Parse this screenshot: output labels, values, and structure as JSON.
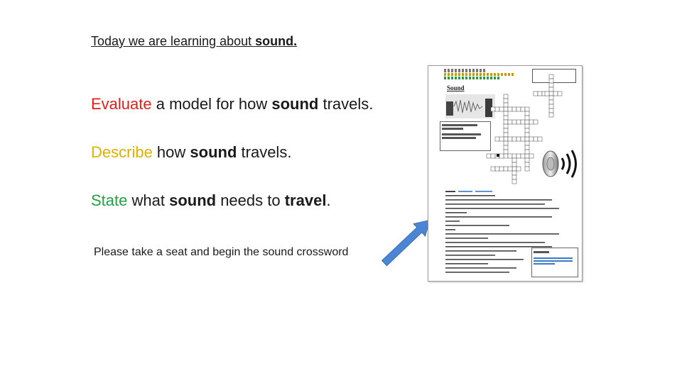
{
  "slide": {
    "title_prefix": "Today we are learning about ",
    "title_bold": "sound.",
    "objectives": [
      {
        "keyword": "Evaluate",
        "color": "#e0201b",
        "t1": " a model for how ",
        "b1": "sound",
        "t2": " travels.",
        "b2": "",
        "t3": ""
      },
      {
        "keyword": "Describe",
        "color": "#e0b000",
        "t1": " how ",
        "b1": "sound",
        "t2": " travels.",
        "b2": "",
        "t3": ""
      },
      {
        "keyword": "State",
        "color": "#22a042",
        "t1": " what ",
        "b1": "sound",
        "t2": " needs to ",
        "b2": "travel",
        "t3": "."
      }
    ],
    "instruction": "Please take a seat and begin the sound crossword",
    "arrow_color": "#4a86d4"
  },
  "worksheet": {
    "title": "Sound"
  },
  "icons": [
    "speaker-icon",
    "arrow-icon"
  ]
}
